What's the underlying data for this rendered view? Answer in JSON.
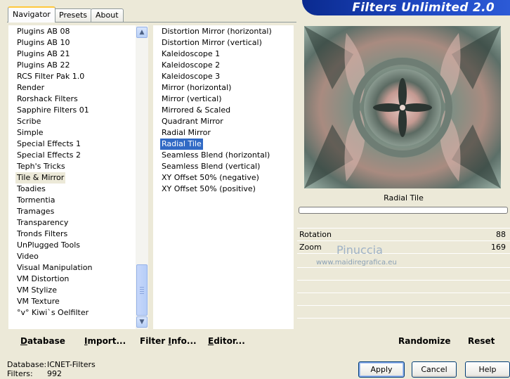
{
  "tabs": [
    "Navigator",
    "Presets",
    "About"
  ],
  "app_title": "Filters Unlimited 2.0",
  "categories": [
    "Plugins AB 08",
    "Plugins AB 10",
    "Plugins AB 21",
    "Plugins AB 22",
    "RCS Filter Pak 1.0",
    "Render",
    "Rorshack Filters",
    "Sapphire Filters 01",
    "Scribe",
    "Simple",
    "Special Effects 1",
    "Special Effects 2",
    "Teph's Tricks",
    "Tile & Mirror",
    "Toadies",
    "Tormentia",
    "Tramages",
    "Transparency",
    "Tronds Filters",
    "UnPlugged Tools",
    "Video",
    "Visual Manipulation",
    "VM Distortion",
    "VM Stylize",
    "VM Texture",
    "°v° Kiwi`s Oelfilter"
  ],
  "selected_category": "Tile & Mirror",
  "filters": [
    "Distortion Mirror (horizontal)",
    "Distortion Mirror (vertical)",
    "Kaleidoscope 1",
    "Kaleidoscope 2",
    "Kaleidoscope 3",
    "Mirror (horizontal)",
    "Mirror (vertical)",
    "Mirrored & Scaled",
    "Quadrant Mirror",
    "Radial Mirror",
    "Radial Tile",
    "Seamless Blend (horizontal)",
    "Seamless Blend (vertical)",
    "XY Offset 50% (negative)",
    "XY Offset 50% (positive)"
  ],
  "selected_filter": "Radial Tile",
  "filter_name": "Radial Tile",
  "params": [
    {
      "label": "Rotation",
      "value": "88"
    },
    {
      "label": "Zoom",
      "value": "169"
    }
  ],
  "watermark": {
    "line1": "Pinuccia",
    "line2": "www.maidiregrafica.eu"
  },
  "toolbar": {
    "database": {
      "u": "D",
      "rest": "atabase"
    },
    "import": {
      "u": "I",
      "rest": "mport..."
    },
    "filter_info": {
      "pre": "Filter ",
      "u": "I",
      "rest": "nfo..."
    },
    "editor": {
      "u": "E",
      "rest": "ditor..."
    },
    "randomize": "Randomize",
    "reset": "Reset"
  },
  "status": {
    "database_label": "Database:",
    "database_value": "ICNET-Filters",
    "filters_label": "Filters:",
    "filters_value": "992"
  },
  "buttons": {
    "apply": "Apply",
    "cancel": "Cancel",
    "help": "Help"
  },
  "colors": {
    "selection": "#316ac5",
    "title_bar": "#1f49c4"
  }
}
